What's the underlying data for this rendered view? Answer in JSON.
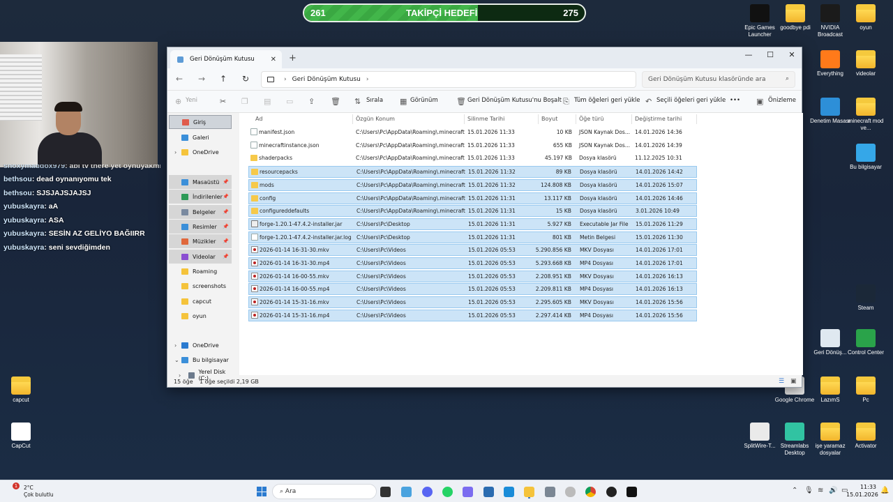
{
  "goal": {
    "current": "261",
    "title": "TAKİPÇİ HEDEFİ",
    "target": "275",
    "progress": 0.62
  },
  "chat": [
    {
      "user": "snoxymaddox979",
      "msg": ": abi tv there yet oynuyakmi",
      "partial": true
    },
    {
      "user": "bethsou",
      "msg": ": dead oynanıyomu tek"
    },
    {
      "user": "bethsou",
      "msg": ": SJSJAJSJAJSJ"
    },
    {
      "user": "yubuskayra",
      "msg": ": aA"
    },
    {
      "user": "yubuskayra",
      "msg": ": ASA"
    },
    {
      "user": "yubuskayra",
      "msg": ": SESİN AZ GELİYO BAĞIIRR"
    },
    {
      "user": "yubuskayra",
      "msg": ": seni sevdiğimden"
    }
  ],
  "desktop": [
    {
      "label": "Epic Games Launcher",
      "icon": "epic-games-icon"
    },
    {
      "label": "goodbye pdi",
      "icon": "folder-icon"
    },
    {
      "label": "NVIDIA Broadcast",
      "icon": "nvidia-broadcast-icon"
    },
    {
      "label": "oyun",
      "icon": "folder-icon"
    },
    {
      "label": "Everything",
      "icon": "everything-search-icon"
    },
    {
      "label": "videolar",
      "icon": "folder-icon"
    },
    {
      "label": "Denetim Masası",
      "icon": "control-panel-icon"
    },
    {
      "label": "minecraft mod ve...",
      "icon": "folder-icon"
    },
    {
      "label": "Bu bilgisayar",
      "icon": "this-pc-icon"
    },
    {
      "label": "Steam",
      "icon": "steam-icon"
    },
    {
      "label": "Geri Dönüş...",
      "icon": "recycle-bin-icon"
    },
    {
      "label": "Control Center",
      "icon": "control-center-icon"
    },
    {
      "label": "capcut",
      "icon": "folder-icon"
    },
    {
      "label": "Google Chrome",
      "icon": "chrome-icon"
    },
    {
      "label": "LazımS",
      "icon": "folder-icon"
    },
    {
      "label": "Pc",
      "icon": "folder-icon"
    },
    {
      "label": "CapCut",
      "icon": "capcut-icon"
    },
    {
      "label": "SplitWire-T...",
      "icon": "splitwire-icon"
    },
    {
      "label": "Streamlabs Desktop",
      "icon": "streamlabs-icon"
    },
    {
      "label": "işe yaramaz dosyalar",
      "icon": "folder-icon"
    },
    {
      "label": "Activator",
      "icon": "folder-icon"
    }
  ],
  "explorer": {
    "tab_title": "Geri Dönüşüm Kutusu",
    "breadcrumb": "Geri Dönüşüm Kutusu",
    "search_placeholder": "Geri Dönüşüm Kutusu klasöründe ara",
    "toolbar": {
      "new": "Yeni",
      "sort": "Sırala",
      "view": "Görünüm",
      "empty_bin": "Geri Dönüşüm Kutusu'nu Boşalt",
      "restore_all": "Tüm öğeleri geri yükle",
      "restore_selected": "Seçili öğeleri geri yükle",
      "more": "•••",
      "preview": "Önizleme"
    },
    "sidebar": [
      {
        "label": "Giriş",
        "icon": "home-icon",
        "color": "#e05b4b"
      },
      {
        "label": "Galeri",
        "icon": "gallery-icon",
        "color": "#3b8fd9"
      },
      {
        "label": "OneDrive",
        "icon": "folder-icon",
        "color": "#f5c33b"
      },
      {
        "label": "Masaüstü",
        "icon": "desktop-icon",
        "color": "#3b8fd9"
      },
      {
        "label": "İndirilenler",
        "icon": "download-icon",
        "color": "#2e9a57"
      },
      {
        "label": "Belgeler",
        "icon": "documents-icon",
        "color": "#7a8aa0"
      },
      {
        "label": "Resimler",
        "icon": "pictures-icon",
        "color": "#3b8fd9"
      },
      {
        "label": "Müzikler",
        "icon": "music-icon",
        "color": "#e0683c"
      },
      {
        "label": "Videolar",
        "icon": "videos-icon",
        "color": "#8a4fd1"
      },
      {
        "label": "Roaming",
        "icon": "folder-icon",
        "color": "#f5c33b"
      },
      {
        "label": "screenshots",
        "icon": "folder-icon",
        "color": "#f5c33b"
      },
      {
        "label": "capcut",
        "icon": "folder-icon",
        "color": "#f5c33b"
      },
      {
        "label": "oyun",
        "icon": "folder-icon",
        "color": "#f5c33b"
      },
      {
        "label": "OneDrive",
        "icon": "onedrive-icon",
        "color": "#2b7bd0"
      },
      {
        "label": "Bu bilgisayar",
        "icon": "this-pc-icon",
        "color": "#3b8fd9"
      },
      {
        "label": "Yerel Disk (C:)",
        "icon": "disk-icon",
        "color": "#6c7a8c"
      }
    ],
    "columns": [
      "Ad",
      "Özgün Konum",
      "Silinme Tarihi",
      "Boyut",
      "Öğe türü",
      "Değiştirme tarihi"
    ],
    "rows": [
      {
        "name": "manifest.json",
        "loc": "C:\\Users\\Pc\\AppData\\Roaming\\.minecraft",
        "del": "15.01.2026 11:33",
        "size": "10 KB",
        "type": "JSON Kaynak Dos...",
        "mod": "14.01.2026 14:36",
        "icon": "doc",
        "sel": false
      },
      {
        "name": "minecraftinstance.json",
        "loc": "C:\\Users\\Pc\\AppData\\Roaming\\.minecraft",
        "del": "15.01.2026 11:33",
        "size": "655 KB",
        "type": "JSON Kaynak Dos...",
        "mod": "14.01.2026 14:39",
        "icon": "doc",
        "sel": false
      },
      {
        "name": "shaderpacks",
        "loc": "C:\\Users\\Pc\\AppData\\Roaming\\.minecraft",
        "del": "15.01.2026 11:33",
        "size": "45.197 KB",
        "type": "Dosya klasörü",
        "mod": "11.12.2025 10:31",
        "icon": "fold",
        "sel": false
      },
      {
        "name": "resourcepacks",
        "loc": "C:\\Users\\Pc\\AppData\\Roaming\\.minecraft",
        "del": "15.01.2026 11:32",
        "size": "89 KB",
        "type": "Dosya klasörü",
        "mod": "14.01.2026 14:42",
        "icon": "fold",
        "sel": true
      },
      {
        "name": "mods",
        "loc": "C:\\Users\\Pc\\AppData\\Roaming\\.minecraft",
        "del": "15.01.2026 11:32",
        "size": "124.808 KB",
        "type": "Dosya klasörü",
        "mod": "14.01.2026 15:07",
        "icon": "fold",
        "sel": true
      },
      {
        "name": "config",
        "loc": "C:\\Users\\Pc\\AppData\\Roaming\\.minecraft",
        "del": "15.01.2026 11:31",
        "size": "13.117 KB",
        "type": "Dosya klasörü",
        "mod": "14.01.2026 14:46",
        "icon": "fold",
        "sel": true
      },
      {
        "name": "configureddefaults",
        "loc": "C:\\Users\\Pc\\AppData\\Roaming\\.minecraft",
        "del": "15.01.2026 11:31",
        "size": "15 KB",
        "type": "Dosya klasörü",
        "mod": "3.01.2026 10:49",
        "icon": "fold",
        "sel": true
      },
      {
        "name": "forge-1.20.1-47.4.2-installer.jar",
        "loc": "C:\\Users\\Pc\\Desktop",
        "del": "15.01.2026 11:31",
        "size": "5.927 KB",
        "type": "Executable Jar File",
        "mod": "15.01.2026 11:29",
        "icon": "jar",
        "sel": true
      },
      {
        "name": "forge-1.20.1-47.4.2-installer.jar.log",
        "loc": "C:\\Users\\Pc\\Desktop",
        "del": "15.01.2026 11:31",
        "size": "801 KB",
        "type": "Metin Belgesi",
        "mod": "15.01.2026 11:30",
        "icon": "doc",
        "sel": true
      },
      {
        "name": "2026-01-14 16-31-30.mkv",
        "loc": "C:\\Users\\Pc\\Videos",
        "del": "15.01.2026 05:53",
        "size": "5.290.856 KB",
        "type": "MKV Dosyası",
        "mod": "14.01.2026 17:01",
        "icon": "vid",
        "sel": true
      },
      {
        "name": "2026-01-14 16-31-30.mp4",
        "loc": "C:\\Users\\Pc\\Videos",
        "del": "15.01.2026 05:53",
        "size": "5.293.668 KB",
        "type": "MP4 Dosyası",
        "mod": "14.01.2026 17:01",
        "icon": "vid",
        "sel": true
      },
      {
        "name": "2026-01-14 16-00-55.mkv",
        "loc": "C:\\Users\\Pc\\Videos",
        "del": "15.01.2026 05:53",
        "size": "2.208.951 KB",
        "type": "MKV Dosyası",
        "mod": "14.01.2026 16:13",
        "icon": "vid",
        "sel": true
      },
      {
        "name": "2026-01-14 16-00-55.mp4",
        "loc": "C:\\Users\\Pc\\Videos",
        "del": "15.01.2026 05:53",
        "size": "2.209.811 KB",
        "type": "MP4 Dosyası",
        "mod": "14.01.2026 16:13",
        "icon": "vid",
        "sel": true
      },
      {
        "name": "2026-01-14 15-31-16.mkv",
        "loc": "C:\\Users\\Pc\\Videos",
        "del": "15.01.2026 05:53",
        "size": "2.295.605 KB",
        "type": "MKV Dosyası",
        "mod": "14.01.2026 15:56",
        "icon": "vid",
        "sel": true
      },
      {
        "name": "2026-01-14 15-31-16.mp4",
        "loc": "C:\\Users\\Pc\\Videos",
        "del": "15.01.2026 05:53",
        "size": "2.297.414 KB",
        "type": "MP4 Dosyası",
        "mod": "14.01.2026 15:56",
        "icon": "vid",
        "sel": true
      }
    ],
    "status": {
      "count": "15 öğe",
      "selected": "1 öğe seçildi  2,19 GB"
    }
  },
  "taskbar": {
    "weather_temp": "2°C",
    "weather_desc": "Çok bulutlu",
    "weather_badge": "1",
    "search": "Ara",
    "time": "11:33",
    "date": "15.01.2026"
  }
}
